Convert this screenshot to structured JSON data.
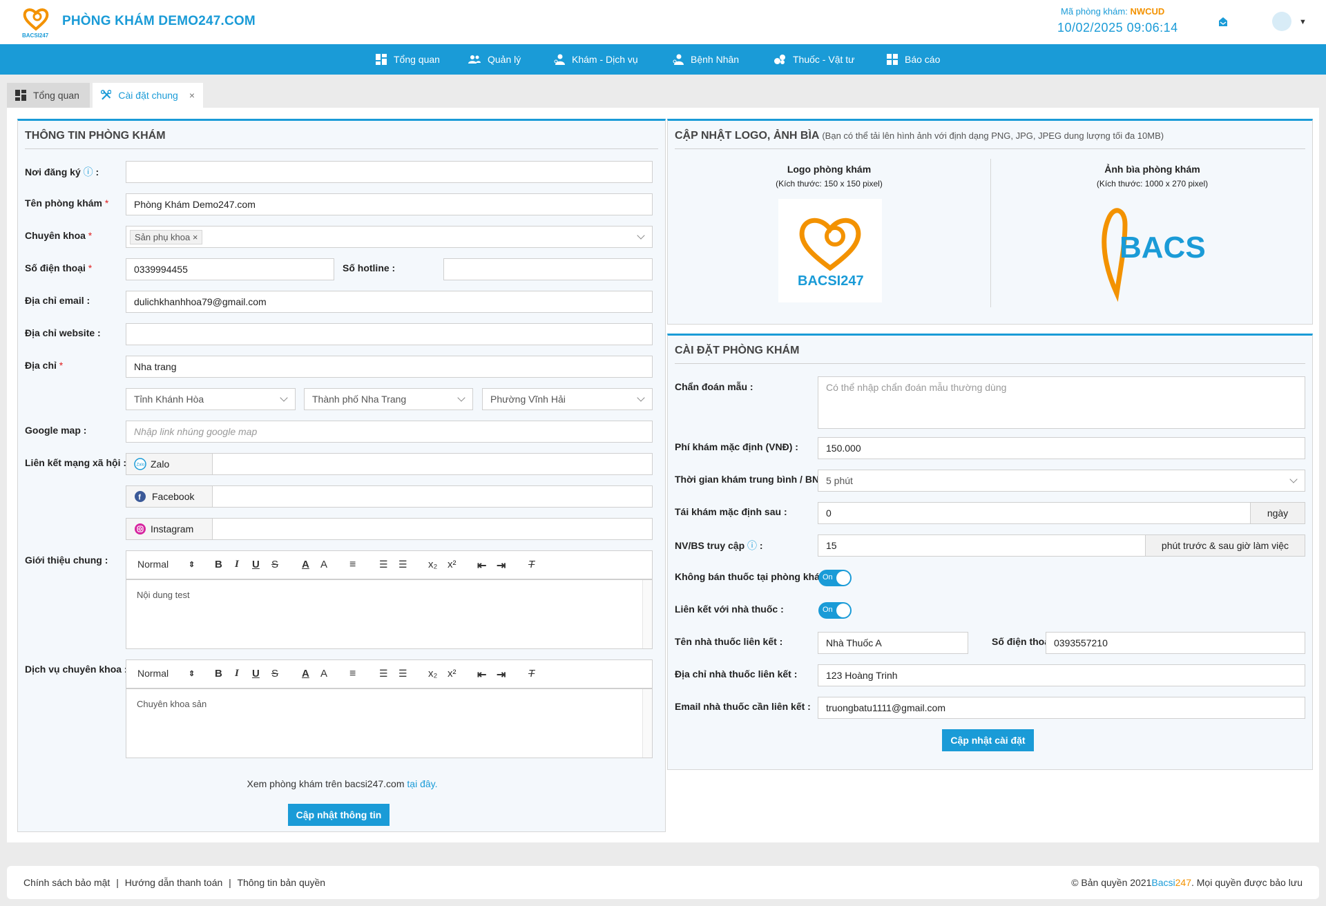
{
  "header": {
    "clinic_name": "PHÒNG KHÁM DEMO247.COM",
    "clinic_code_label": "Mã phòng khám:",
    "clinic_code": "NWCUD",
    "datetime": "10/02/2025 09:06:14",
    "brand_colors": {
      "primary": "#1a9bd7",
      "accent": "#f39200"
    }
  },
  "nav": {
    "items": [
      {
        "label": "Tổng quan",
        "icon": "dashboard-icon"
      },
      {
        "label": "Quản lý",
        "icon": "users-icon"
      },
      {
        "label": "Khám - Dịch vụ",
        "icon": "doctor-icon"
      },
      {
        "label": "Bệnh Nhân",
        "icon": "patient-icon"
      },
      {
        "label": "Thuốc - Vật tư",
        "icon": "pills-icon"
      },
      {
        "label": "Báo cáo",
        "icon": "report-icon"
      }
    ]
  },
  "tabs": {
    "overview": "Tổng quan",
    "settings": "Cài đặt chung",
    "close_glyph": "×"
  },
  "info_panel": {
    "title": "THÔNG TIN PHÒNG KHÁM",
    "registration_label": "Nơi đăng ký",
    "registration_value": "",
    "name_label": "Tên phòng khám",
    "name_value": "Phòng Khám Demo247.com",
    "specialty_label": "Chuyên khoa",
    "specialty_tag": "Sản phụ khoa",
    "phone_label": "Số điện thoại",
    "phone_value": "0339994455",
    "hotline_label": "Số hotline",
    "hotline_value": "",
    "email_label": "Địa chỉ email",
    "email_value": "dulichkhanhhoa79@gmail.com",
    "website_label": "Địa chỉ website",
    "website_value": "",
    "address_label": "Địa chỉ",
    "address_value": "Nha trang",
    "province": "Tỉnh Khánh Hòa",
    "city": "Thành phố Nha Trang",
    "ward": "Phường Vĩnh Hải",
    "map_label": "Google map",
    "map_placeholder": "Nhập link nhúng google map",
    "social_label": "Liên kết mạng xã hội",
    "zalo_label": "Zalo",
    "facebook_label": "Facebook",
    "instagram_label": "Instagram",
    "intro_label": "Giới thiệu chung",
    "intro_content": "Nội dung test",
    "service_label": "Dịch vụ chuyên khoa",
    "service_content": "Chuyên khoa sản",
    "editor_format": "Normal",
    "view_text": "Xem phòng khám trên bacsi247.com",
    "view_link": "tại đây",
    "submit_label": "Cập nhật thông tin"
  },
  "logo_panel": {
    "title": "CẬP NHẬT LOGO, ẢNH BÌA",
    "title_note": "(Bạn có thể tải lên hình ảnh với định dạng PNG, JPG, JPEG dung lượng tối đa 10MB)",
    "logo_title": "Logo phòng khám",
    "logo_size": "(Kích thước: 150 x 150 pixel)",
    "cover_title": "Ảnh bìa phòng khám",
    "cover_size": "(Kích thước: 1000 x 270 pixel)",
    "logo_brand_text": "BACSI247"
  },
  "settings_panel": {
    "title": "CÀI ĐẶT PHÒNG KHÁM",
    "diagnosis_label": "Chẩn đoán mẫu",
    "diagnosis_placeholder": "Có thể nhập chẩn đoán mẫu thường dùng",
    "fee_label": "Phí khám mặc định (VNĐ)",
    "fee_value": "150.000",
    "avg_time_label": "Thời gian khám trung bình / BN",
    "avg_time_value": "5 phút",
    "revisit_label": "Tái khám mặc định sau",
    "revisit_value": "0",
    "revisit_unit": "ngày",
    "staff_access_label": "NV/BS truy cập",
    "staff_access_value": "15",
    "staff_access_unit": "phút trước & sau giờ làm việc",
    "no_drug_sale_label": "Không bán thuốc tại phòng khám",
    "pharmacy_link_label": "Liên kết với nhà thuốc",
    "toggle_on": "On",
    "pharmacy_name_label": "Tên nhà thuốc liên kết",
    "pharmacy_name_value": "Nhà Thuốc A",
    "pharmacy_phone_label": "Số điện thoại",
    "pharmacy_phone_value": "0393557210",
    "pharmacy_address_label": "Địa chỉ nhà thuốc liên kết",
    "pharmacy_address_value": "123 Hoàng Trinh",
    "pharmacy_email_label": "Email nhà thuốc cần liên kết",
    "pharmacy_email_value": "truongbatu1111@gmail.com",
    "submit_label": "Cập nhật cài đặt"
  },
  "footer": {
    "privacy": "Chính sách bảo mật",
    "payment_guide": "Hướng dẫn thanh toán",
    "copyright_info": "Thông tin bản quyền",
    "copyright_prefix": "© Bản quyền 2021",
    "brand_a": "Bacsi",
    "brand_b": "247",
    "copyright_suffix": ". Mọi quyền được bảo lưu"
  }
}
